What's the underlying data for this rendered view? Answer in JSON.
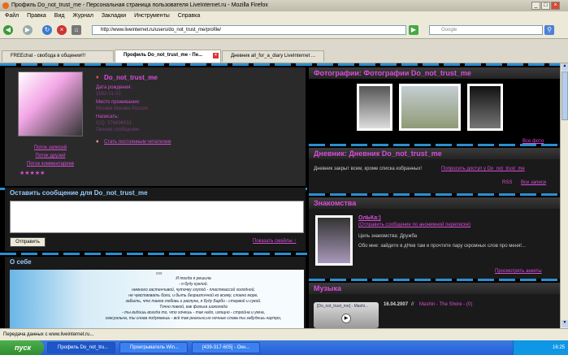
{
  "window": {
    "title": "Профиль Do_not_trust_me - Персональная страница пользователя LiveInternet.ru - Mozilla Firefox"
  },
  "menu": [
    "Файл",
    "Правка",
    "Вид",
    "Журнал",
    "Закладки",
    "Инструменты",
    "Справка"
  ],
  "nav": {
    "url": "http://www.liveinternet.ru/users/do_not_trust_me/profile/",
    "search_placeholder": "Google"
  },
  "tabs": [
    {
      "label": "FREEchat - свобода в общении!!!"
    },
    {
      "label": "Профиль Do_not_trust_me - Пе..."
    },
    {
      "label": "Дневник all_for_a_diary LiveInternet ..."
    }
  ],
  "profile": {
    "username": "Do_not_trust_me",
    "birth_label": "Дата рождения:",
    "birth_value": "1992-01-03",
    "place_label": "Место проживания:",
    "place_value": "Москва Москва Россия",
    "contact_label": "Написать:",
    "contact_value": "ICQ: 376696931",
    "contact_value2": "Личное сообщение",
    "reader_link": "Стать постоянным читателем",
    "links": [
      "Поток записей",
      "Поток друзей",
      "Поток комментариев"
    ],
    "stars": "★★★★★"
  },
  "message": {
    "title": "Оставить сообщение для Do_not_trust_me",
    "send": "Отправить",
    "smileys": "Показать смайлы ↑"
  },
  "about": {
    "title": "О себе",
    "dots": "ххх",
    "poem": [
      "И тогда я решила",
      "- я буду куклой.",
      "немного застенчивой, чуточку глупой - пластмассой холодной,",
      "не чувствовать боли, и быть безразличной ко всему, словно море,",
      "забыть, что такое любовь и разлука, я буду Барби - стервой и сукой.",
      "Точно такой, как фольга шоколада",
      "- ты видишь всегда то, что хочешь - так надо, изящно - стройна и умна,",
      "сексуальна, ты снова подумаешь - всё так реально,но ночные слова ты забудешь наутро,"
    ]
  },
  "photos": {
    "title": "Фотографии: Фотографии Do_not_trust_me",
    "all_link": "Все фото"
  },
  "diary": {
    "title": "Дневник: Дневник Do_not_trust_me",
    "notice": "Дневник закрыт всем, кроме списка избранных!",
    "request": "Попросить доступ у Do_not_trust_me",
    "rss": "RSS",
    "all_link": "Все записи"
  },
  "acquaint": {
    "title": "Знакомства",
    "name": "ОлЬКа:)",
    "anon": "(Отправить сообщение по анонимной переписке)",
    "goal": "Цель знакомства: Дружба",
    "about": "Обо мне: зайдите в дНев там и прочтите пару скромных слов про меня!...",
    "view": "Просмотреть анкеты"
  },
  "music": {
    "title": "Музыка",
    "player": "[Do_not_trust_me] - Mashi...",
    "date": "16.04.2007",
    "track": "Mashin - The Shore - (0)"
  },
  "status": "Передача данных с www.liveinternet.ru...",
  "taskbar": {
    "start": "пуск",
    "tasks": [
      "Профиль Do_not_tru...",
      "Проигрыватель Win...",
      "[439-317-605] - Окн..."
    ],
    "clock": "16:25"
  },
  "colors": {
    "accent": "#d84fd8",
    "stripe": "#2a8fd0",
    "panel": "#2a2a2a"
  }
}
